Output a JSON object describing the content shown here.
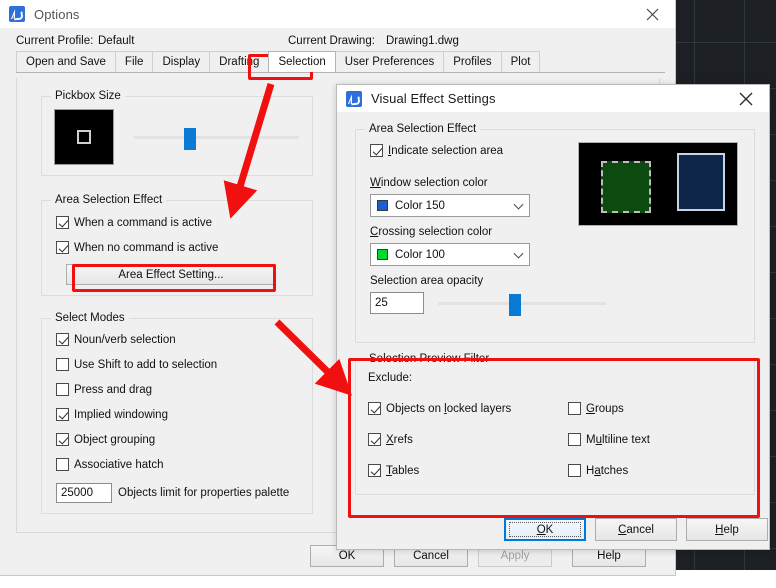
{
  "background": {
    "name": "autocad-drawing-area"
  },
  "options_dialog": {
    "title": "Options",
    "close_label": "✕",
    "profile": {
      "current_profile_label": "Current Profile:",
      "current_profile_value": "Default",
      "current_drawing_label": "Current Drawing:",
      "current_drawing_value": "Drawing1.dwg"
    },
    "tabs": [
      {
        "label": "Open and Save",
        "active": false
      },
      {
        "label": "File",
        "active": false
      },
      {
        "label": "Display",
        "active": false
      },
      {
        "label": "Drafting",
        "active": false
      },
      {
        "label": "Selection",
        "active": true
      },
      {
        "label": "User Preferences",
        "active": false
      },
      {
        "label": "Profiles",
        "active": false
      },
      {
        "label": "Plot",
        "active": false
      }
    ],
    "pickbox": {
      "group_title": "Pickbox Size",
      "slider_value": 30
    },
    "area_selection_effect": {
      "group_title": "Area Selection Effect",
      "items": [
        {
          "label": "When a command is active",
          "checked": true
        },
        {
          "label": "When no command is active",
          "checked": true
        }
      ],
      "button_label": "Area Effect Setting..."
    },
    "select_modes": {
      "group_title": "Select Modes",
      "items": [
        {
          "label": "Noun/verb selection",
          "checked": true
        },
        {
          "label": "Use Shift to add to selection",
          "checked": false
        },
        {
          "label": "Press and drag",
          "checked": false
        },
        {
          "label": "Implied windowing",
          "checked": true
        },
        {
          "label": "Object grouping",
          "checked": true
        },
        {
          "label": "Associative hatch",
          "checked": false
        }
      ],
      "object_limit_value": "25000",
      "object_limit_label": "Objects limit for properties palette"
    },
    "footer_buttons": [
      {
        "label": "OK",
        "disabled": false
      },
      {
        "label": "Cancel",
        "disabled": false
      },
      {
        "label": "Apply",
        "disabled": true
      },
      {
        "label": "Help",
        "disabled": false
      }
    ]
  },
  "visual_effect_dialog": {
    "title": "Visual Effect Settings",
    "close_label": "✕",
    "area_selection_effect": {
      "group_title": "Area Selection Effect",
      "indicate_label": "Indicate selection area",
      "indicate_checked": true,
      "window_color_label": "Window selection color",
      "window_color_value": "Color 150",
      "window_color_hex": "#1a5fd6",
      "crossing_color_label": "Crossing selection color",
      "crossing_color_value": "Color 100",
      "crossing_color_hex": "#00d92b",
      "opacity_label": "Selection area opacity",
      "opacity_value": "25",
      "opacity_slider_percent": 42
    },
    "preview": {
      "name": "selection-preview-image",
      "crossing_fill": "#0d4a10",
      "window_fill": "#0d2549",
      "background": "#000000"
    },
    "preview_filter": {
      "group_title": "Selection Preview Filter",
      "exclude_label": "Exclude:",
      "left_column": [
        {
          "label": "Objects on locked layers",
          "checked": true,
          "accel": "l"
        },
        {
          "label": "Xrefs",
          "checked": true,
          "accel": "X"
        },
        {
          "label": "Tables",
          "checked": true,
          "accel": "T"
        }
      ],
      "right_column": [
        {
          "label": "Groups",
          "checked": false,
          "accel": "G"
        },
        {
          "label": "Multiline text",
          "checked": false,
          "accel": "u"
        },
        {
          "label": "Hatches",
          "checked": false,
          "accel": "a"
        }
      ]
    },
    "footer_buttons": [
      {
        "label": "OK",
        "accel": "O",
        "focused": true
      },
      {
        "label": "Cancel",
        "accel": "C",
        "focused": false
      },
      {
        "label": "Help",
        "accel": "H",
        "focused": false
      }
    ]
  },
  "annotations": {
    "highlight_color": "#f01010",
    "boxes": [
      {
        "name": "selection-tab-highlight"
      },
      {
        "name": "area-effect-setting-highlight"
      },
      {
        "name": "selection-preview-filter-highlight"
      }
    ],
    "arrows": [
      {
        "name": "arrow-to-area-effect-setting"
      },
      {
        "name": "arrow-to-selection-preview-filter"
      }
    ]
  }
}
